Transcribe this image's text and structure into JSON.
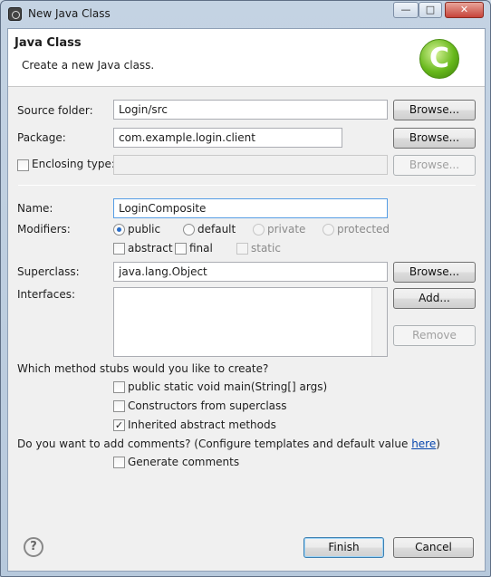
{
  "window": {
    "title": "New Java Class",
    "controls": {
      "minimize": "—",
      "maximize": "□",
      "close": "✕"
    }
  },
  "banner": {
    "title": "Java Class",
    "description": "Create a new Java class.",
    "logo_letter": "C",
    "logo_color": "#67b81b"
  },
  "form": {
    "source_folder": {
      "label": "Source folder:",
      "value": "Login/src",
      "browse": "Browse..."
    },
    "package": {
      "label": "Package:",
      "value": "com.example.login.client",
      "browse": "Browse..."
    },
    "enclosing_type": {
      "label": "Enclosing type:",
      "value": "",
      "checked": false,
      "browse": "Browse..."
    },
    "name": {
      "label": "Name:",
      "value": "LoginComposite"
    },
    "modifiers": {
      "label": "Modifiers:",
      "access": [
        {
          "label": "public",
          "selected": true,
          "enabled": true
        },
        {
          "label": "default",
          "selected": false,
          "enabled": true
        },
        {
          "label": "private",
          "selected": false,
          "enabled": false
        },
        {
          "label": "protected",
          "selected": false,
          "enabled": false
        }
      ],
      "flags": [
        {
          "label": "abstract",
          "checked": false,
          "enabled": true
        },
        {
          "label": "final",
          "checked": false,
          "enabled": true
        },
        {
          "label": "static",
          "checked": false,
          "enabled": false
        }
      ]
    },
    "superclass": {
      "label": "Superclass:",
      "value": "java.lang.Object",
      "browse": "Browse..."
    },
    "interfaces": {
      "label": "Interfaces:",
      "add": "Add...",
      "remove": "Remove"
    },
    "stubs": {
      "question": "Which method stubs would you like to create?",
      "options": [
        {
          "label": "public static void main(String[] args)",
          "checked": false
        },
        {
          "label": "Constructors from superclass",
          "checked": false
        },
        {
          "label": "Inherited abstract methods",
          "checked": true
        }
      ]
    },
    "comments": {
      "question": "Do you want to add comments? (Configure templates and default value ",
      "link": "here",
      "question_end": ")",
      "option": {
        "label": "Generate comments",
        "checked": false
      }
    }
  },
  "footer": {
    "help_icon": "?",
    "finish": "Finish",
    "cancel": "Cancel"
  }
}
